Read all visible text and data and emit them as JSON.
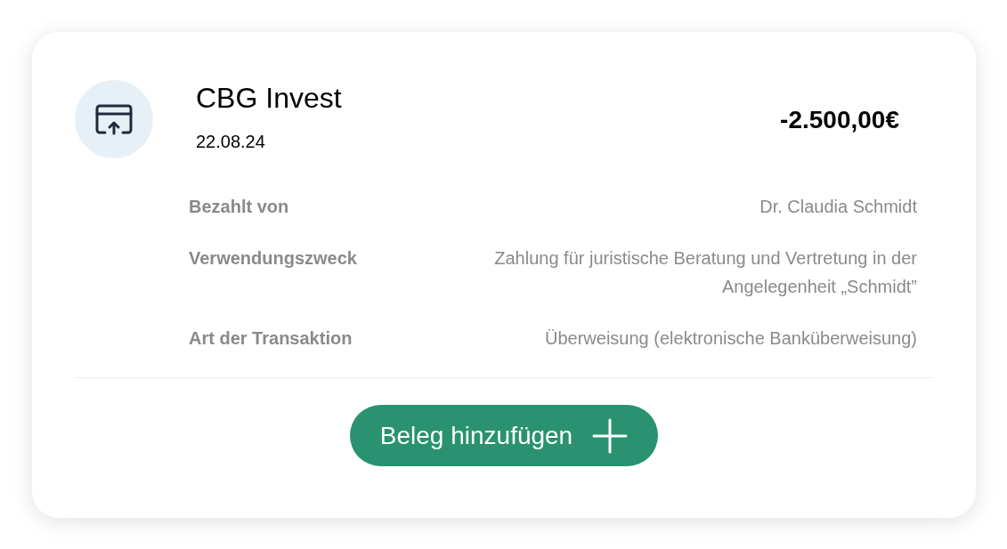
{
  "transaction": {
    "payee": "CBG Invest",
    "date": "22.08.24",
    "amount": "-2.500,00€"
  },
  "details": [
    {
      "label": "Bezahlt von",
      "value": "Dr. Claudia Schmidt"
    },
    {
      "label": "Verwendungszweck",
      "value": "Zahlung für juristische Beratung und Vertretung in der Angelegenheit „Schmidt”"
    },
    {
      "label": "Art der Transaktion",
      "value": "Überweisung (elektronische Banküberweisung)"
    }
  ],
  "button": {
    "label": "Beleg hinzufügen"
  }
}
